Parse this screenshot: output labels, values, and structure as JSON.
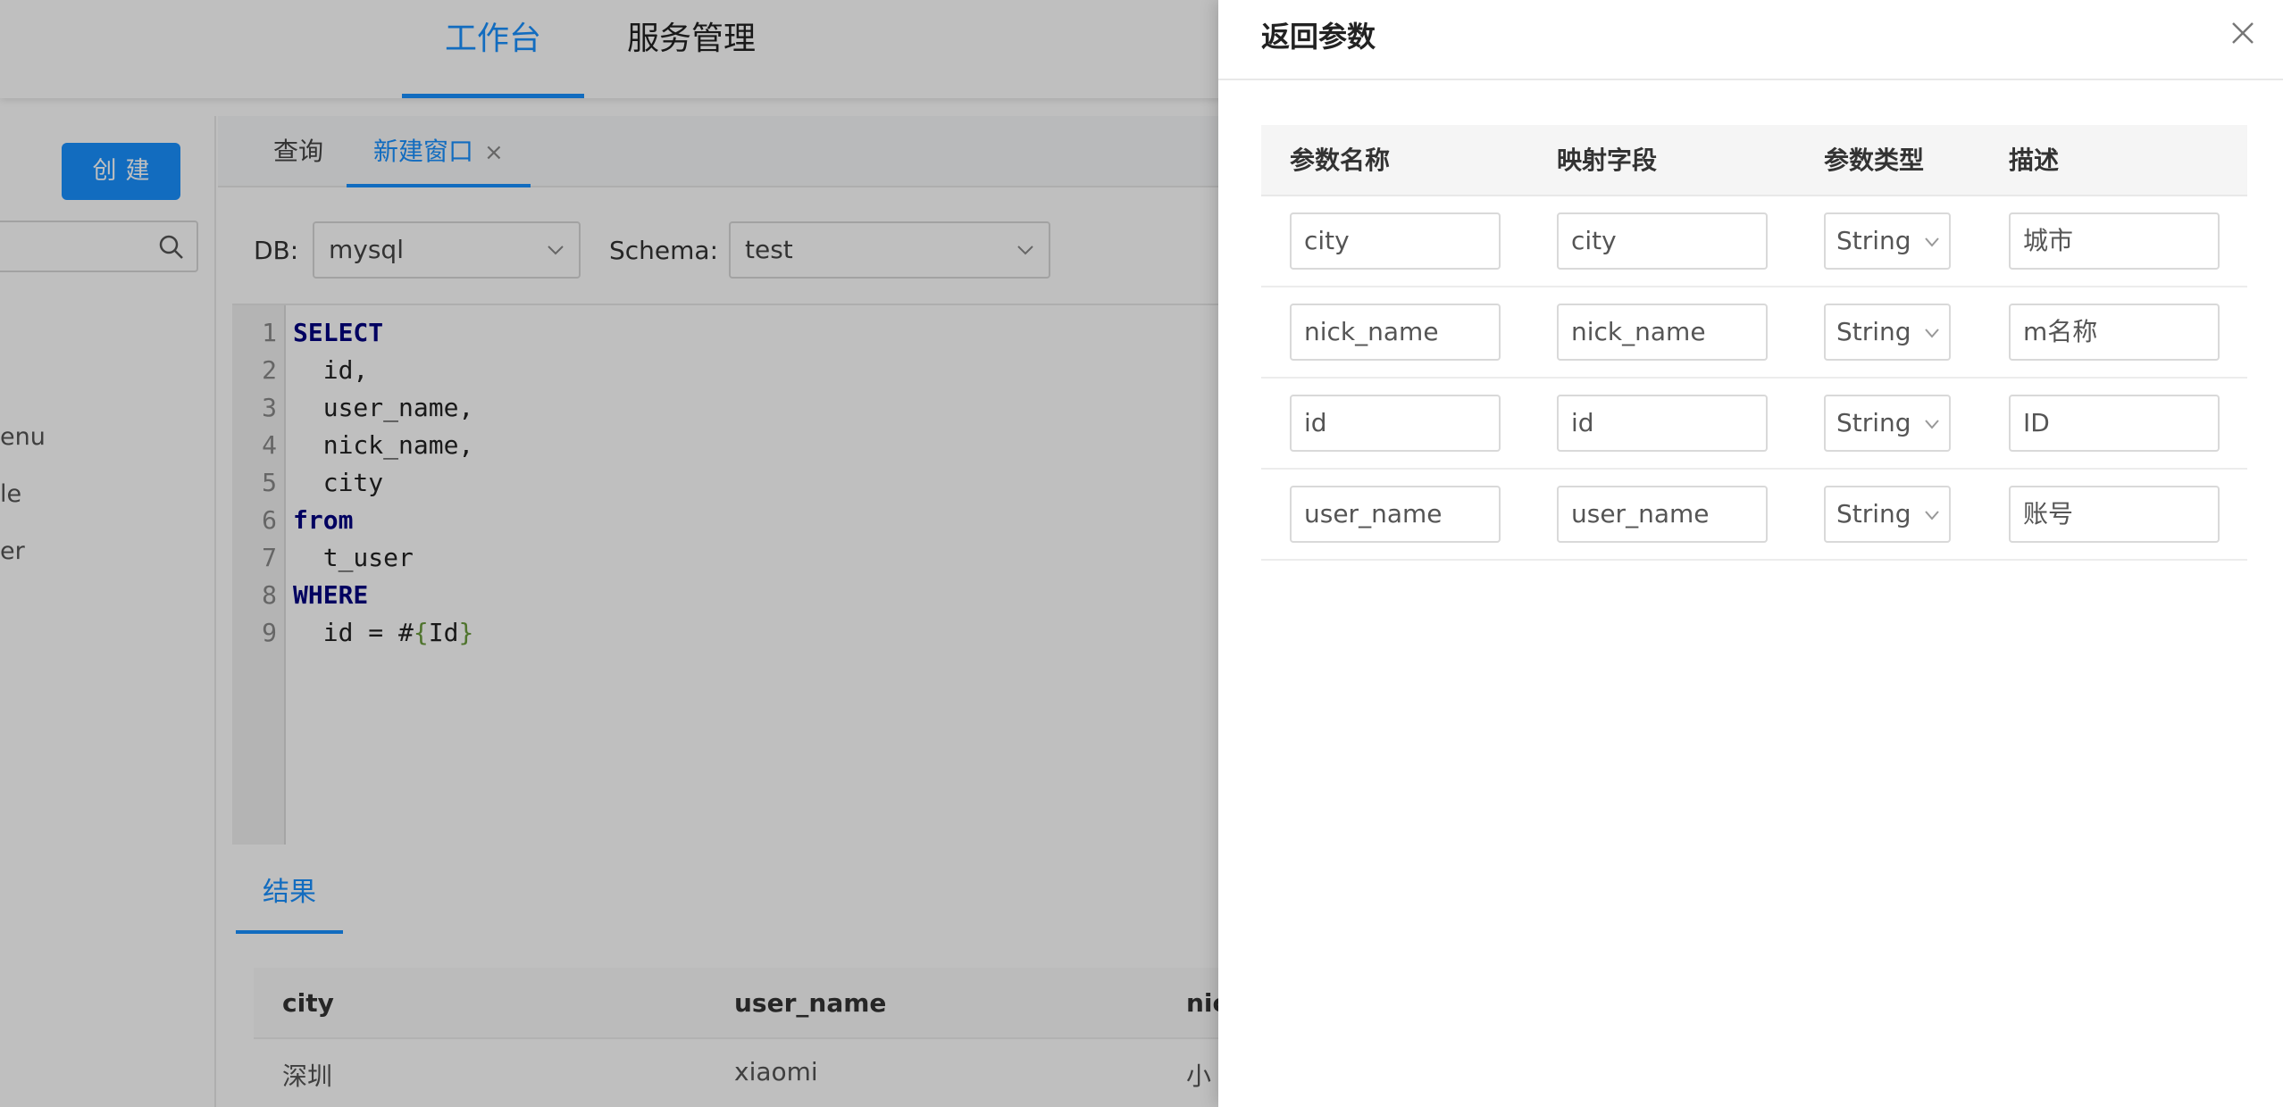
{
  "topnav": {
    "items": [
      "工作台",
      "服务管理"
    ]
  },
  "sidebar": {
    "create_label": "创建",
    "items": [
      "enu",
      "le",
      "er"
    ]
  },
  "main_tabs": {
    "query_label": "查询",
    "new_window_label": "新建窗口",
    "close_glyph": "×"
  },
  "filters": {
    "db_label": "DB:",
    "db_value": "mysql",
    "schema_label": "Schema:",
    "schema_value": "test"
  },
  "editor": {
    "line_numbers": [
      "1",
      "2",
      "3",
      "4",
      "5",
      "6",
      "7",
      "8",
      "9"
    ],
    "lines": [
      [
        {
          "t": "SELECT",
          "c": "kw"
        }
      ],
      [
        {
          "t": "  id,",
          "c": ""
        }
      ],
      [
        {
          "t": "  user_name,",
          "c": ""
        }
      ],
      [
        {
          "t": "  nick_name,",
          "c": ""
        }
      ],
      [
        {
          "t": "  city",
          "c": ""
        }
      ],
      [
        {
          "t": "from",
          "c": "kw"
        }
      ],
      [
        {
          "t": "  t_user",
          "c": ""
        }
      ],
      [
        {
          "t": "WHERE",
          "c": "kw"
        }
      ],
      [
        {
          "t": "  id = #",
          "c": ""
        },
        {
          "t": "{",
          "c": "br"
        },
        {
          "t": "Id",
          "c": ""
        },
        {
          "t": "}",
          "c": "br"
        }
      ]
    ]
  },
  "results": {
    "tab_label": "结果",
    "columns": [
      "city",
      "user_name",
      "nic"
    ],
    "first_row": [
      "深圳",
      "xiaomi",
      "小"
    ]
  },
  "drawer": {
    "title": "返回参数",
    "columns": [
      "参数名称",
      "映射字段",
      "参数类型",
      "描述"
    ],
    "rows": [
      {
        "name": "city",
        "field": "city",
        "type": "String",
        "desc": "城市"
      },
      {
        "name": "nick_name",
        "field": "nick_name",
        "type": "String",
        "desc": "m名称"
      },
      {
        "name": "id",
        "field": "id",
        "type": "String",
        "desc": "ID"
      },
      {
        "name": "user_name",
        "field": "user_name",
        "type": "String",
        "desc": "账号"
      }
    ]
  }
}
